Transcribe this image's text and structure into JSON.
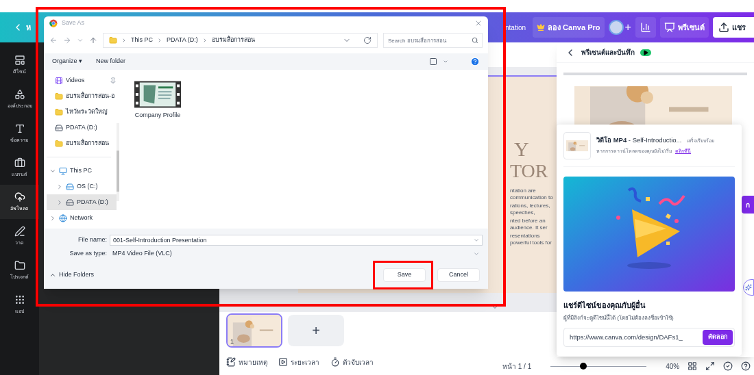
{
  "topbar": {
    "back_text": "ห",
    "title_fragment": "ntation",
    "pro_button": "ลอง Canva Pro",
    "add": "+",
    "present_button": "พรีเซนต์",
    "share_button": "แชร"
  },
  "sidebar": {
    "items": [
      {
        "kind": "template",
        "label": "ดีไซน์",
        "selected": false
      },
      {
        "kind": "elements",
        "label": "องค์ประกอบ",
        "selected": false
      },
      {
        "kind": "text",
        "label": "ข้อความ",
        "selected": false
      },
      {
        "kind": "brand",
        "label": "แบรนด์",
        "selected": false
      },
      {
        "kind": "upload",
        "label": "อัพโหลด",
        "selected": true
      },
      {
        "kind": "draw",
        "label": "วาด",
        "selected": false
      },
      {
        "kind": "projects",
        "label": "โปรเจกต์",
        "selected": false
      },
      {
        "kind": "apps",
        "label": "แอป",
        "selected": false
      }
    ]
  },
  "slide": {
    "title_lines": [
      "Y",
      "TOR"
    ],
    "body_lines": [
      "ntation are communication to",
      "rations, lectures, speeches,",
      "nted before an audience. It ser",
      "resentations powerful tools for"
    ]
  },
  "pages": {
    "thumbnails": [
      {
        "number": "1",
        "selected": true
      }
    ],
    "add": "+"
  },
  "bottom_bar": {
    "notes": "หมายเหตุ",
    "duration": "ระยะเวลา",
    "timer": "ตัวจับเวลา",
    "page": "หน้า 1 / 1",
    "zoom": {
      "level": 0.34,
      "reading": "40%"
    }
  },
  "present_panel": {
    "title": "พรีเซนต์และบันทึก",
    "side_button": "ก"
  },
  "download_popup": {
    "file_title": "**วิดีโอ MP4** - Self-Introductio...",
    "status": "เสร็จเรียบร้อย",
    "hint": "หากการดาวน์โหลดของคุณยังไม่เริ่ม",
    "hint_link": "คลิกที่นี่",
    "share_heading": "แชร์ดีไซน์ของคุณกับผู้อื่น",
    "share_text": "ผู้ที่มีลิงก์จะดูดีไซน์นี้ได้ (โดยไม่ต้องลงชื่อเข้าใช้)",
    "url": "https://www.canva.com/design/DAFs1_",
    "copy_button": "คัดลอก"
  },
  "dialog": {
    "title": "Save As",
    "highlighted": true,
    "path": [
      "This PC",
      "PDATA (D:)",
      "อบรมสื่อการสอน"
    ],
    "search_placeholder": "Search อบรมสื่อการสอน",
    "organize": "Organize ▾",
    "new_folder": "New folder",
    "quick_access": [
      {
        "kind": "video",
        "label": "Videos",
        "pinned": true
      },
      {
        "kind": "folder",
        "label": "อบรมสื่อการสอน-อ",
        "pinned": false
      },
      {
        "kind": "folder",
        "label": "ไหว้พระวัดใหญ่",
        "pinned": false
      },
      {
        "kind": "drive",
        "label": "PDATA (D:)",
        "pinned": false
      },
      {
        "kind": "folder",
        "label": "อบรมสื่อการสอน",
        "pinned": false
      }
    ],
    "tree": [
      {
        "kind": "pc",
        "label": "This PC",
        "expanded": true,
        "selected": false,
        "children": [
          {
            "kind": "os",
            "label": "OS (C:)",
            "expanded": false,
            "selected": false
          },
          {
            "kind": "drive",
            "label": "PDATA (D:)",
            "expanded": false,
            "selected": true
          }
        ]
      },
      {
        "kind": "network",
        "label": "Network",
        "expanded": false,
        "selected": false
      }
    ],
    "files": [
      {
        "label": "Company Profile"
      }
    ],
    "file_name_label": "File name:",
    "file_name": "001-Self-Introduction Presentation",
    "type_label": "Save as type:",
    "type": "MP4 Video File (VLC)",
    "hide_folders": "Hide Folders",
    "save_button": "Save",
    "save_highlighted": true,
    "cancel_button": "Cancel"
  }
}
